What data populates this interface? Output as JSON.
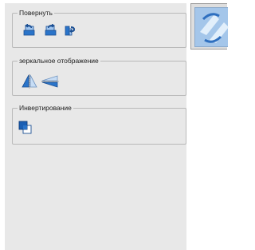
{
  "groups": {
    "rotate": {
      "title": "Повернуть",
      "buttons": [
        {
          "icon": "rotate-left-icon"
        },
        {
          "icon": "rotate-right-icon"
        },
        {
          "icon": "rotate-180-icon"
        }
      ]
    },
    "mirror": {
      "title": "зеркальное отображение",
      "buttons": [
        {
          "icon": "flip-vertical-icon"
        },
        {
          "icon": "flip-horizontal-icon"
        }
      ]
    },
    "invert": {
      "title": "Инвертирование",
      "buttons": [
        {
          "icon": "invert-colors-icon"
        }
      ]
    }
  },
  "colors": {
    "panel_bg": "#e8e8e8",
    "icon_blue": "#2a74c9",
    "icon_light": "#9fc4ee",
    "icon_dark": "#1b4f93"
  }
}
